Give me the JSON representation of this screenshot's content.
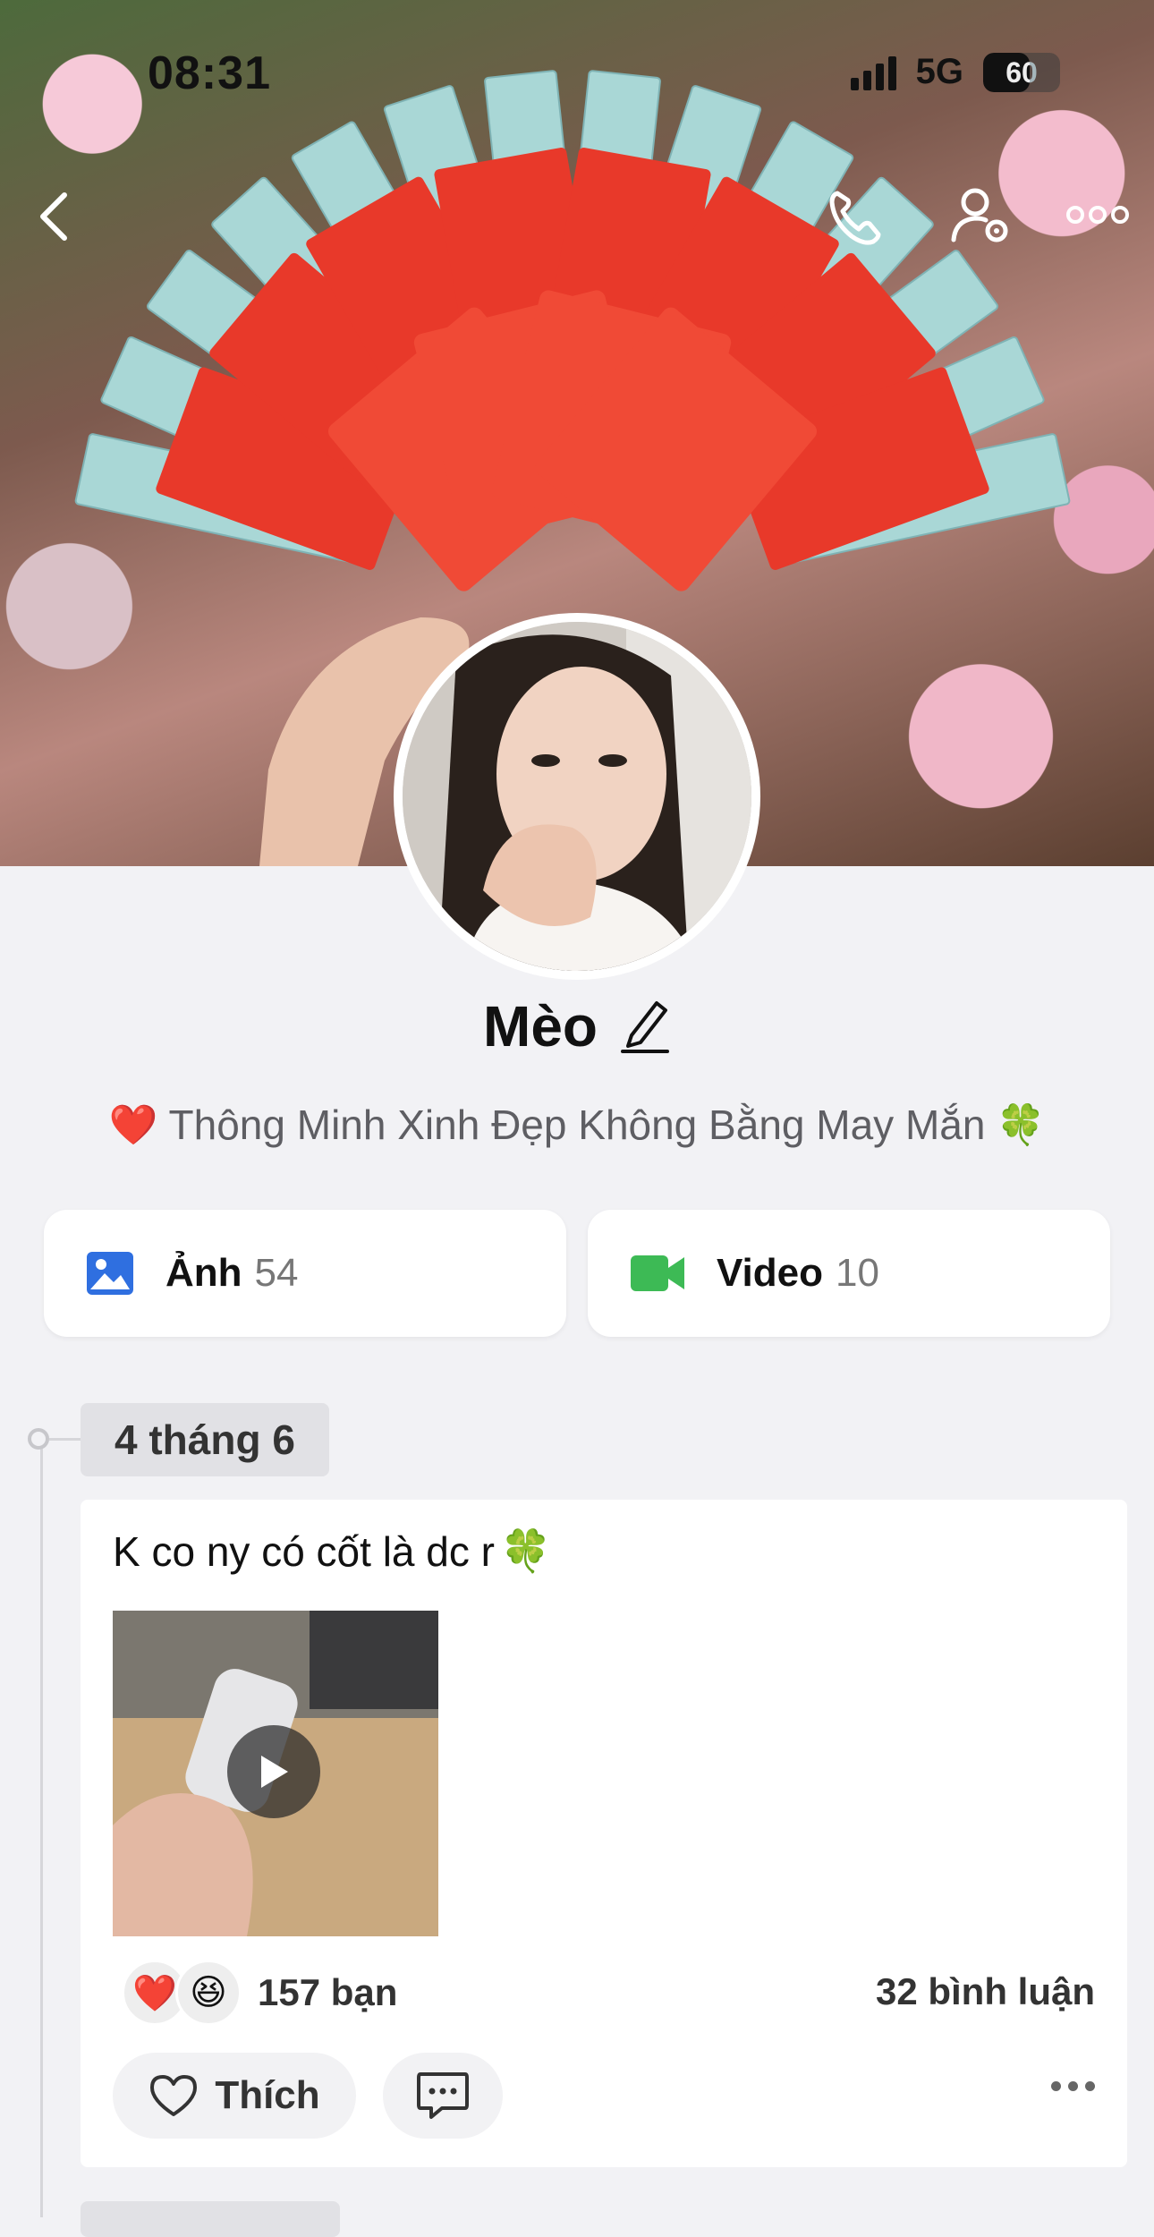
{
  "status": {
    "time": "08:31",
    "network": "5G",
    "battery": "60",
    "battery_level": 0.6
  },
  "nav": {
    "back_icon": "chevron-left-icon",
    "call_icon": "phone-icon",
    "settings_icon": "user-settings-icon",
    "more_icon": "more-dots-icon"
  },
  "profile": {
    "name": "Mèo",
    "bio": "Thông Minh Xinh Đẹp Không Bằng May Mắn",
    "bio_prefix_emoji": "❤️",
    "bio_suffix_emoji": "🍀"
  },
  "media": {
    "photos": {
      "label": "Ảnh",
      "count": "54",
      "color": "#2f6fe0"
    },
    "videos": {
      "label": "Video",
      "count": "10",
      "color": "#3dba55"
    }
  },
  "timeline": {
    "date": "4 tháng 6",
    "post": {
      "text": "K co ny có cốt là dc r",
      "text_emoji": "🍀",
      "reaction_emojis": [
        "❤️",
        "😆"
      ],
      "reactions_text": "157 bạn",
      "comments_text": "32 bình luận",
      "like_label": "Thích"
    }
  }
}
